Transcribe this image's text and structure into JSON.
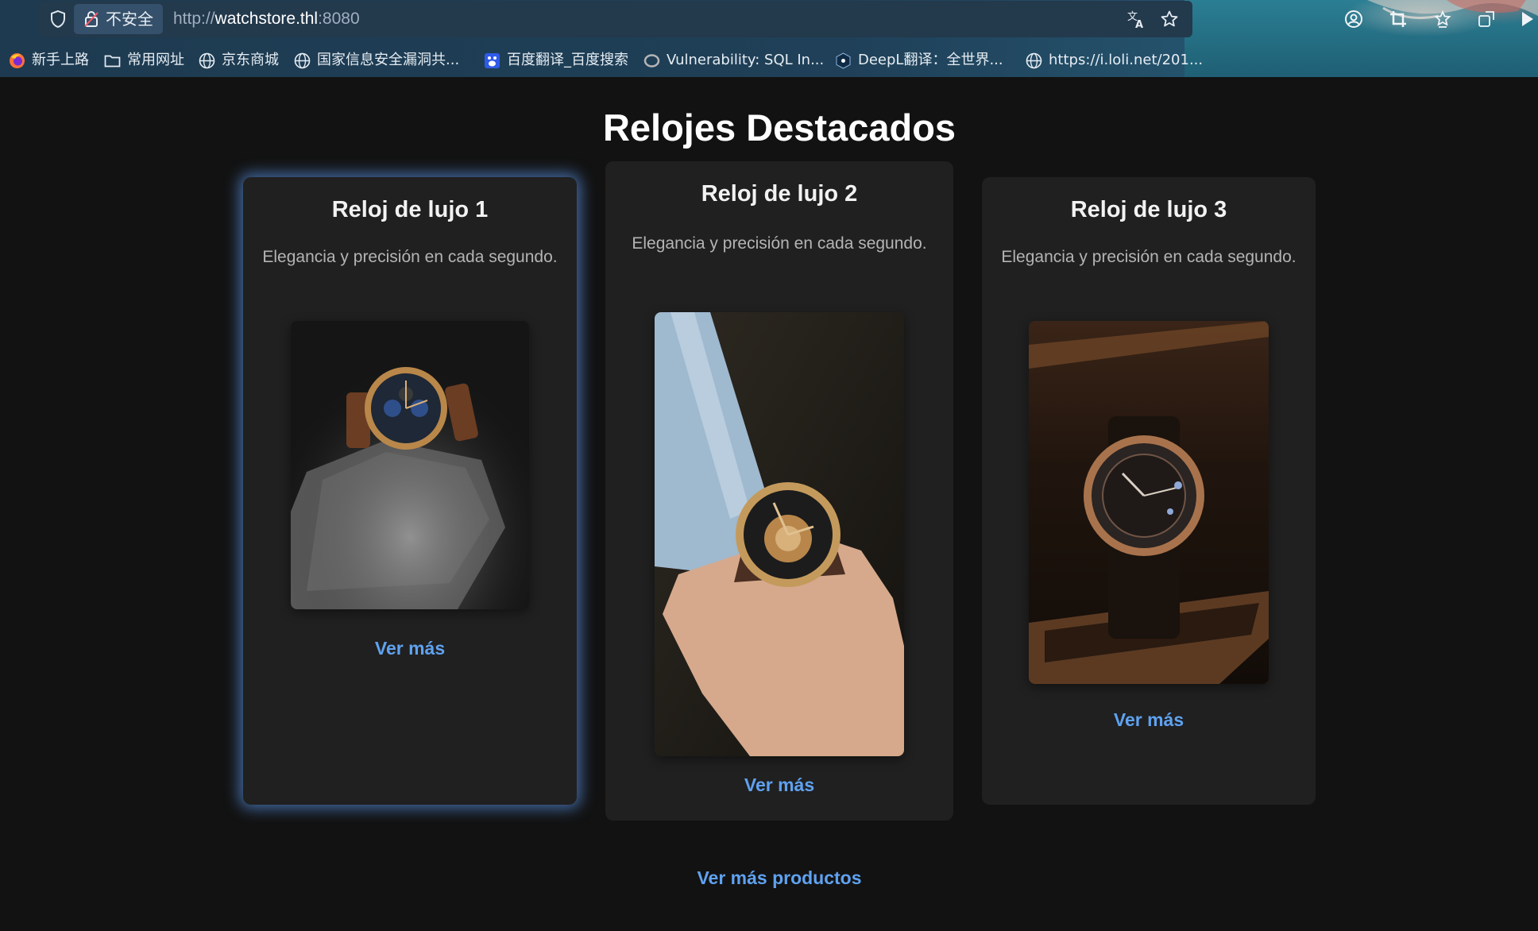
{
  "browser": {
    "insecure_label": "不安全",
    "url_scheme": "http://",
    "url_host": "watchstore.thl",
    "url_port": ":8080",
    "bookmarks": [
      {
        "label": "新手上路",
        "icon": "firefox-icon"
      },
      {
        "label": "常用网址",
        "icon": "folder-icon"
      },
      {
        "label": "京东商城",
        "icon": "globe-icon"
      },
      {
        "label": "国家信息安全漏洞共...",
        "icon": "globe-icon"
      },
      {
        "label": "百度翻译_百度搜索",
        "icon": "baidu-icon"
      },
      {
        "label": "Vulnerability: SQL In...",
        "icon": "dvwa-icon"
      },
      {
        "label": "DeepL翻译：全世界...",
        "icon": "deepl-icon"
      },
      {
        "label": "https://i.loli.net/201...",
        "icon": "globe-icon"
      }
    ]
  },
  "page": {
    "title": "Relojes Destacados",
    "cards": [
      {
        "title": "Reloj de lujo 1",
        "description": "Elegancia y precisión en cada segundo.",
        "image": "watch-on-rock-image",
        "link": "Ver más"
      },
      {
        "title": "Reloj de lujo 2",
        "description": "Elegancia y precisión en cada segundo.",
        "image": "watch-on-wrist-image",
        "link": "Ver más"
      },
      {
        "title": "Reloj de lujo 3",
        "description": "Elegancia y precisión en cada segundo.",
        "image": "watch-in-box-image",
        "link": "Ver más"
      }
    ],
    "more_products": "Ver más productos"
  },
  "colors": {
    "background": "#121212",
    "card": "#202020",
    "link": "#5fa2f0",
    "featured_glow": "#5c96eb"
  }
}
